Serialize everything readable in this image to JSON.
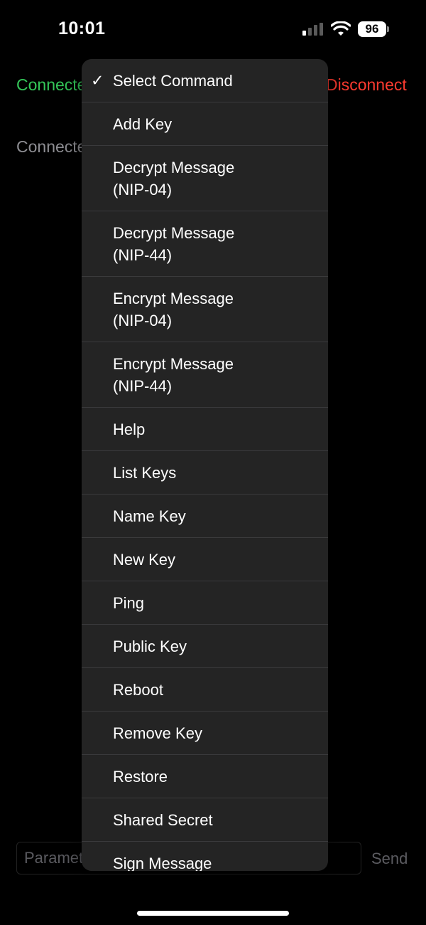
{
  "status_bar": {
    "time": "10:01",
    "battery": "96",
    "icons": [
      "cellular-signal-icon",
      "wifi-icon",
      "battery-icon"
    ]
  },
  "controls": {
    "connect_label": "Connected",
    "disconnect_label": "Disconnect",
    "connection_status": "Connected",
    "param_placeholder": "Parameters",
    "send_label": "Send"
  },
  "menu": {
    "selected_index": 0,
    "items": [
      {
        "label": "Select Command",
        "tall": false
      },
      {
        "label": "Add Key",
        "tall": false
      },
      {
        "label": "Decrypt Message (NIP-04)",
        "tall": true
      },
      {
        "label": "Decrypt Message (NIP-44)",
        "tall": true
      },
      {
        "label": "Encrypt Message (NIP-04)",
        "tall": true
      },
      {
        "label": "Encrypt Message (NIP-44)",
        "tall": true
      },
      {
        "label": "Help",
        "tall": false
      },
      {
        "label": "List Keys",
        "tall": false
      },
      {
        "label": "Name Key",
        "tall": false
      },
      {
        "label": "New Key",
        "tall": false
      },
      {
        "label": "Ping",
        "tall": false
      },
      {
        "label": "Public Key",
        "tall": false
      },
      {
        "label": "Reboot",
        "tall": false
      },
      {
        "label": "Remove Key",
        "tall": false
      },
      {
        "label": "Restore",
        "tall": false
      },
      {
        "label": "Shared Secret",
        "tall": false
      },
      {
        "label": "Sign Message",
        "tall": false
      }
    ]
  },
  "colors": {
    "connect": "#34c759",
    "disconnect": "#ff3b30",
    "menu_bg": "#242424",
    "separator": "#3a3a3c"
  }
}
